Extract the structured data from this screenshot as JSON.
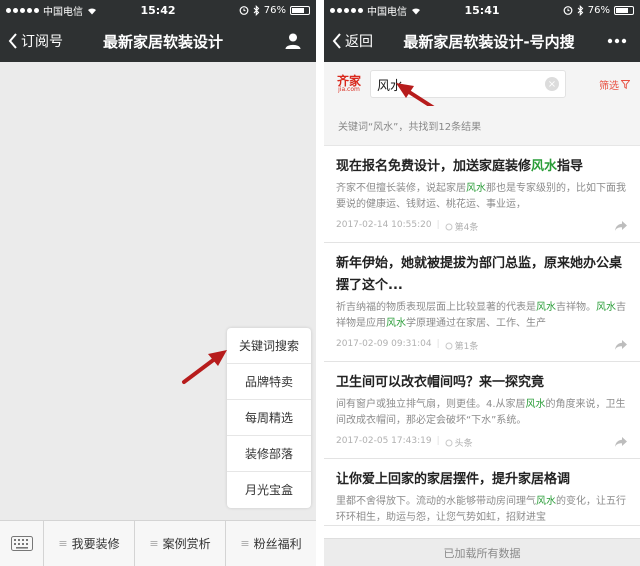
{
  "left": {
    "status": {
      "carrier": "中国电信",
      "time": "15:42",
      "battery": "76%",
      "battery_level": 0.76
    },
    "nav": {
      "back_label": "订阅号",
      "title": "最新家居软装设计"
    },
    "popup_menu": [
      "关键词搜索",
      "品牌特卖",
      "每周精选",
      "装修部落",
      "月光宝盒"
    ],
    "bottom_tabs": [
      "我要装修",
      "案例赏析",
      "粉丝福利"
    ]
  },
  "right": {
    "status": {
      "carrier": "中国电信",
      "time": "15:41",
      "battery": "76%",
      "battery_level": 0.76
    },
    "nav": {
      "back_label": "返回",
      "title": "最新家居软装设计-号内搜"
    },
    "logo": {
      "text": "齐家",
      "sub": "jia.com"
    },
    "search": {
      "value": "风水"
    },
    "filter_label": "筛选",
    "summary": "关键词“风水”，共找到12条结果",
    "results": [
      {
        "title": "现在报名免费设计，加送家庭装修风水指导",
        "desc": "齐家不但擅长装修，说起家居风水那也是专家级别的，比如下面我要说的健康运、钱财运、桃花运、事业运，",
        "date": "2017-02-14 10:55:20",
        "likes": "第4条"
      },
      {
        "title": "新年伊始，她就被提拔为部门总监，原来她办公桌摆了这个...",
        "desc": "祈吉纳福的物质表现层面上比较显著的代表是风水吉祥物。风水吉祥物是应用风水学原理通过在家居、工作、生产",
        "date": "2017-02-09 09:31:04",
        "likes": "第1条"
      },
      {
        "title": "卫生间可以改衣帽间吗？来一探究竟",
        "desc": "间有窗户或独立排气扇，则更佳。4.从家居风水的角度来说，卫生间改成衣帽间，那必定会破坏“下水”系统。",
        "date": "2017-02-05 17:43:19",
        "likes": "头条"
      },
      {
        "title": "让你爱上回家的家居摆件，提升家居格调",
        "desc": "里都不舍得放下。流动的水能够带动房间理气风水的变化，让五行环环相生，助运与怨，让您气势如虹，招财进宝",
        "date": "",
        "likes": ""
      }
    ],
    "footer": "已加载所有数据"
  },
  "colors": {
    "nav_bg": "#2e3132",
    "highlight": "#2a9d38",
    "accent_red": "#e84e40",
    "arrow_red": "#b71c1c"
  }
}
